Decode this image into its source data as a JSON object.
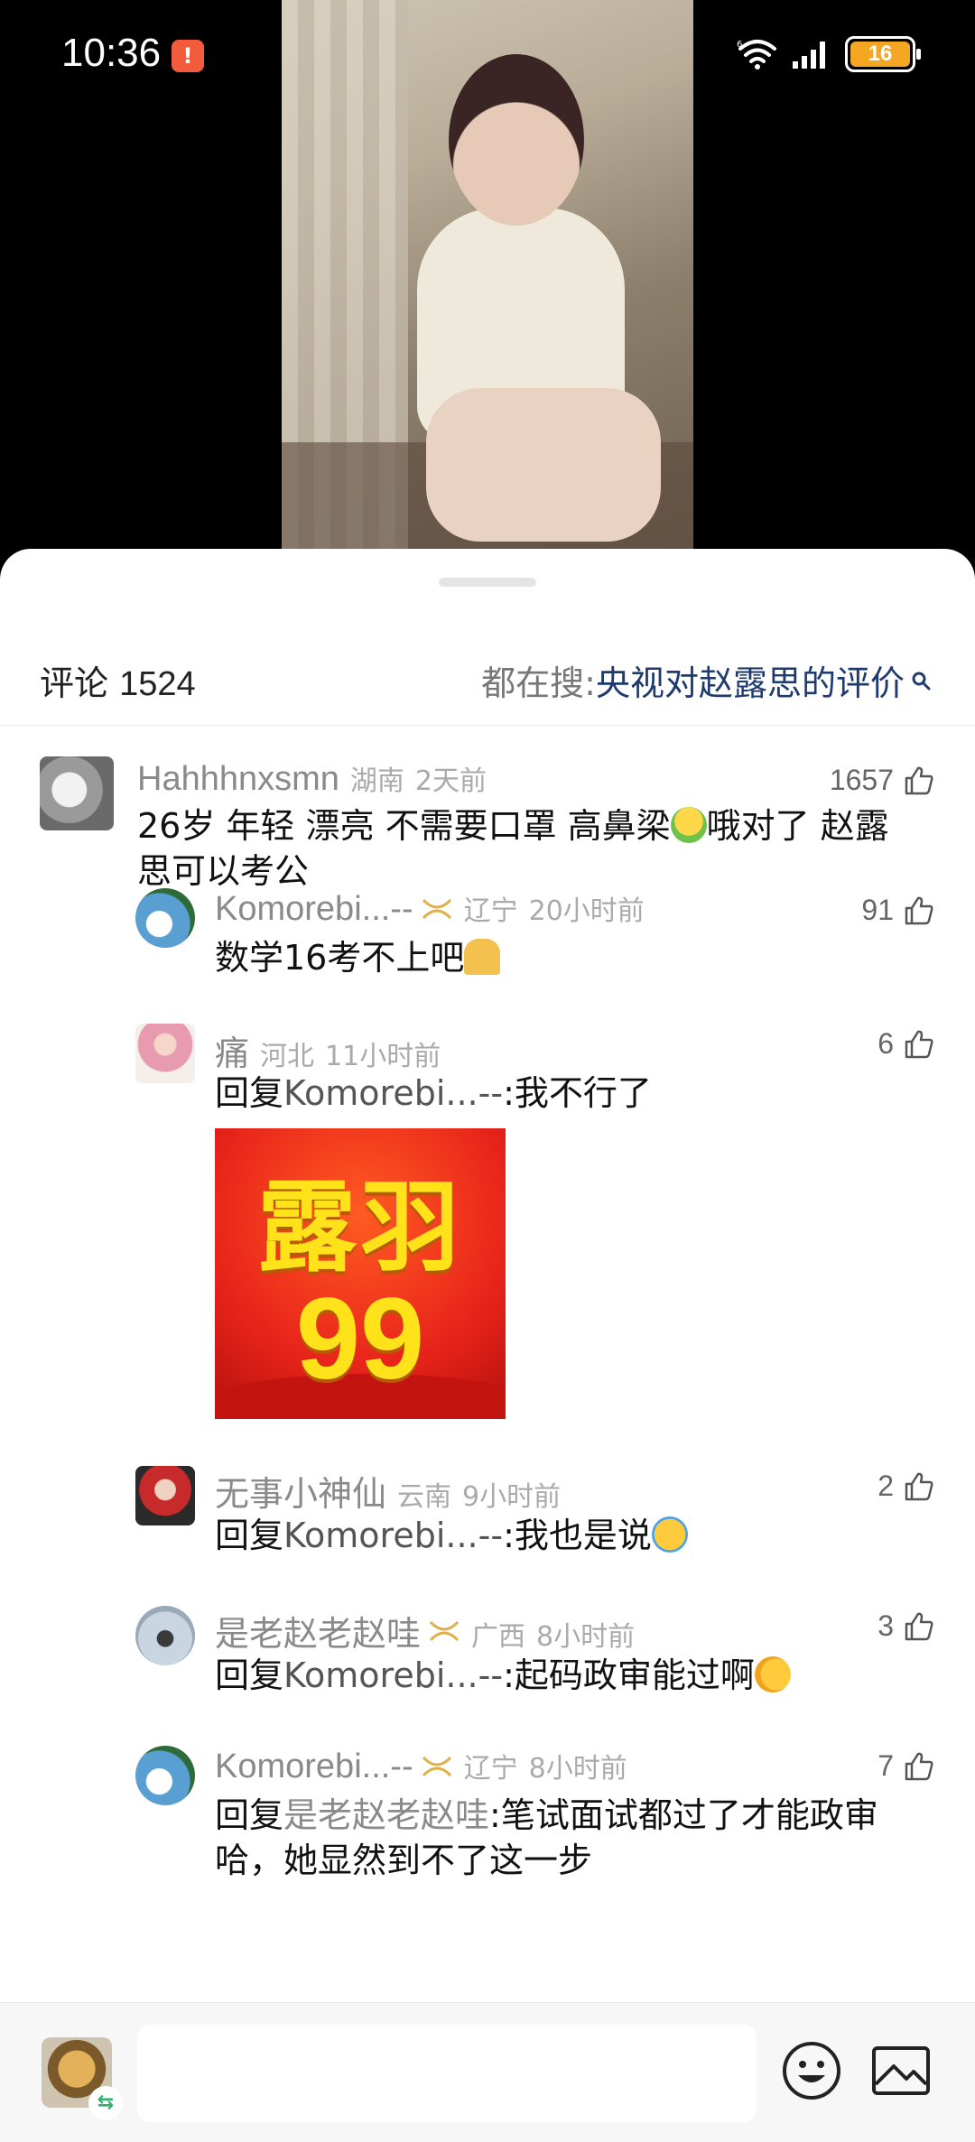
{
  "status_bar": {
    "time": "10:36",
    "alert_badge": "!",
    "battery": "16"
  },
  "comments_panel": {
    "title": "评论",
    "count": "1524",
    "search_prefix": "都在搜:",
    "search_query": "央视对赵露思的评价"
  },
  "comments": [
    {
      "name": "Hahhhnxsmn",
      "location": "湖南",
      "time": "2天前",
      "likes": "1657",
      "text_line1_a": "26岁 年轻 漂亮 不需要口罩 高鼻梁",
      "text_line1_b": "哦对了 赵露",
      "text_line2": "思可以考公"
    },
    {
      "name": "Komorebi...--",
      "location": "辽宁",
      "time": "20小时前",
      "likes": "91",
      "text": "数学16考不上吧"
    },
    {
      "name": "痛",
      "location": "河北",
      "time": "11小时前",
      "likes": "6",
      "reply_prefix": "回复",
      "reply_to": "Komorebi...--",
      "text": ":我不行了",
      "sticker_top": "露羽",
      "sticker_bottom": "99"
    },
    {
      "name": "无事小神仙",
      "location": "云南",
      "time": "9小时前",
      "likes": "2",
      "reply_prefix": "回复",
      "reply_to": "Komorebi...--",
      "text": ":我也是说"
    },
    {
      "name": "是老赵老赵哇",
      "location": "广西",
      "time": "8小时前",
      "likes": "3",
      "reply_prefix": "回复",
      "reply_to": "Komorebi...--",
      "text": ":起码政审能过啊"
    },
    {
      "name": "Komorebi...--",
      "location": "辽宁",
      "time": "8小时前",
      "likes": "7",
      "reply_prefix": "回复",
      "reply_to": "是老赵老赵哇",
      "text_line1": ":笔试面试都过了才能政审",
      "text_line2": "哈，她显然到不了这一步"
    }
  ],
  "input_bar": {
    "placeholder": "",
    "switch_symbol": "⇆"
  },
  "colors": {
    "accent_query": "#1f3a6e",
    "battery": "#f5a623",
    "sticker_red": "#e8241a",
    "sticker_yellow": "#ffe21a"
  }
}
